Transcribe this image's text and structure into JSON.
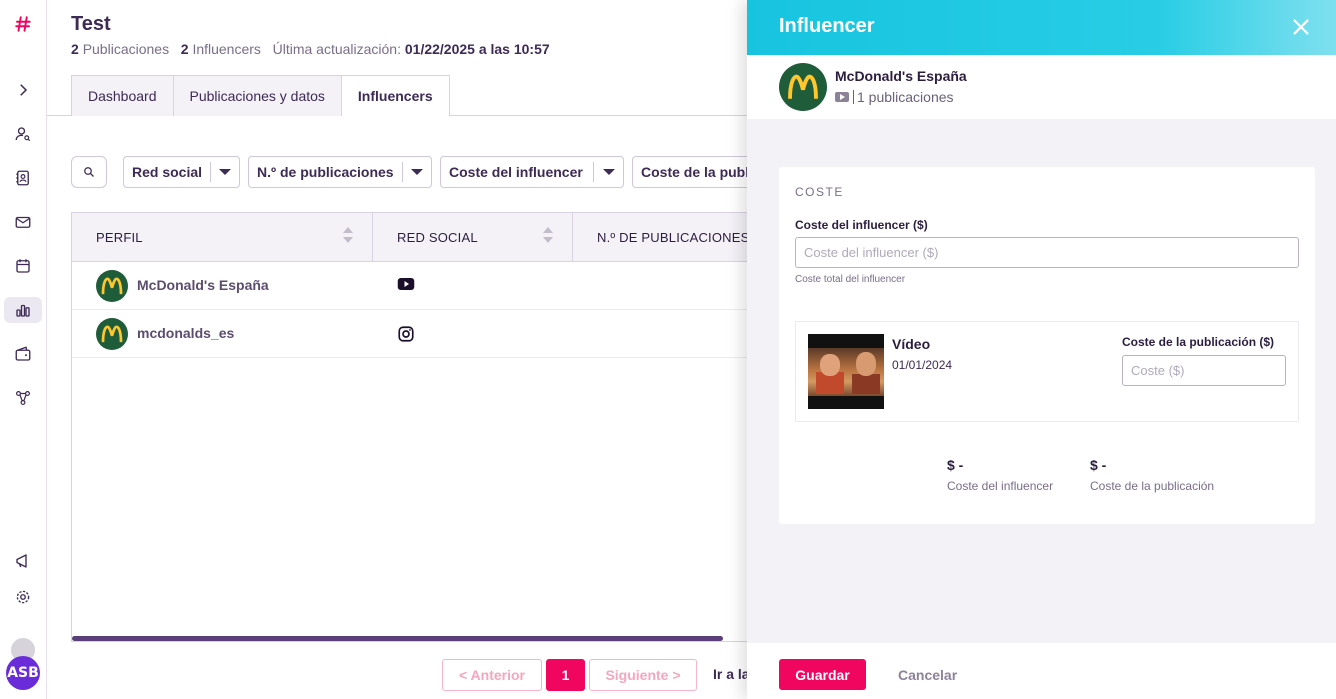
{
  "app": {
    "brand_color": "#f0065f"
  },
  "sidebar": {
    "avatar_initials": "ASB",
    "icons": [
      "hash-logo-icon",
      "chevron-right-icon",
      "user-search-icon",
      "contacts-icon",
      "mail-icon",
      "calendar-icon",
      "bar-chart-icon",
      "wallet-icon",
      "share-network-icon",
      "megaphone-icon",
      "gear-icon"
    ]
  },
  "header": {
    "title": "Test",
    "publications_count": "2",
    "publications_label": "Publicaciones",
    "influencers_count": "2",
    "influencers_label": "Influencers",
    "updated_label": "Última actualización:",
    "updated_value": "01/22/2025 a las 10:57"
  },
  "tabs": [
    {
      "label": "Dashboard",
      "active": false
    },
    {
      "label": "Publicaciones y datos",
      "active": false
    },
    {
      "label": "Influencers",
      "active": true
    }
  ],
  "filters": [
    "Red social",
    "N.º de publicaciones",
    "Coste del influencer",
    "Coste de la publicación"
  ],
  "table": {
    "headers": [
      "PERFIL",
      "RED SOCIAL",
      "N.º DE PUBLICACIONES"
    ],
    "rows": [
      {
        "name": "McDonald's España",
        "network": "youtube"
      },
      {
        "name": "mcdonalds_es",
        "network": "instagram"
      }
    ]
  },
  "pagination": {
    "prev": "< Anterior",
    "current": "1",
    "next": "Siguiente >",
    "goto": "Ir a la"
  },
  "drawer": {
    "title": "Influencer",
    "profile_name": "McDonald's España",
    "profile_sub": "1 publicaciones",
    "section": "COSTE",
    "influencer_cost_label": "Coste del influencer ($)",
    "influencer_cost_placeholder": "Coste del influencer ($)",
    "influencer_cost_hint": "Coste total del influencer",
    "post": {
      "type": "Vídeo",
      "date": "01/01/2024",
      "cost_label": "Coste de la publicación ($)",
      "cost_placeholder": "Coste ($)"
    },
    "totals": [
      {
        "value": "$ -",
        "label": "Coste del influencer"
      },
      {
        "value": "$ -",
        "label": "Coste de la publicación"
      }
    ],
    "save": "Guardar",
    "cancel": "Cancelar"
  }
}
